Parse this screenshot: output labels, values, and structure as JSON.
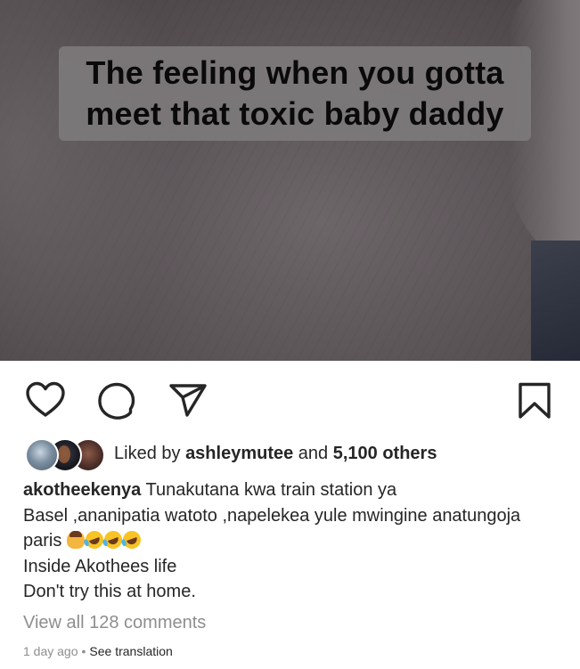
{
  "post": {
    "media": {
      "overlay_text_line1": "The feeling when you gotta",
      "overlay_text_line2": "meet that toxic baby daddy"
    },
    "actions": {
      "like_icon": "heart-icon",
      "comment_icon": "comment-icon",
      "share_icon": "send-icon",
      "save_icon": "bookmark-icon"
    },
    "likes": {
      "prefix": "Liked by ",
      "user": "ashleymutee",
      "middle": " and ",
      "count": "5,100 others"
    },
    "caption": {
      "username": "akotheekenya",
      "line1": " Tunakutana kwa train station ya",
      "line2": "Basel ,ananipatia  watoto ,napelekea yule mwingine anatungoja",
      "line3": "paris ",
      "emojis": [
        "person-pouting-emoji",
        "rofl-emoji",
        "rofl-emoji",
        "rofl-emoji"
      ],
      "line4": "Inside Akothees life",
      "line5": "Don't try this at home."
    },
    "comments_link": "View all 128 comments",
    "timestamp": "1 day ago",
    "separator": "•",
    "translation_link": "See translation"
  },
  "colors": {
    "text": "#262626",
    "secondary_text": "#8e8e8e",
    "overlay_box": "#7d797b",
    "overlay_text": "#0a0a0a"
  }
}
